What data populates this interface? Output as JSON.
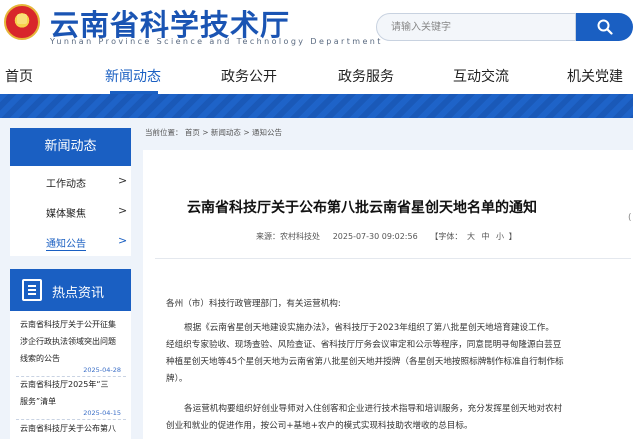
{
  "header": {
    "site_title": "云南省科学技术厅",
    "site_subtitle": "Yunnan Province Science and Technology Department",
    "search_placeholder": "请输入关键字"
  },
  "nav": [
    "首页",
    "新闻动态",
    "政务公开",
    "政务服务",
    "互动交流",
    "机关党建"
  ],
  "sidebar": {
    "section_title": "新闻动态",
    "items": [
      {
        "label": "工作动态",
        "chevron": ">"
      },
      {
        "label": "媒体聚焦",
        "chevron": ">"
      },
      {
        "label": "通知公告",
        "chevron": ">"
      }
    ],
    "hot_title": "热点资讯",
    "hot": [
      {
        "lines": [
          "云南省科技厅关于公开征集",
          "涉企行政执法领域突出问题",
          "线索的公告"
        ],
        "date": "2025-04-28"
      },
      {
        "lines": [
          "云南省科技厅2025年“三",
          "服务”清单"
        ],
        "date": "2025-04-15"
      },
      {
        "lines": [
          "云南省科技厅关于公布第八"
        ],
        "date": ""
      }
    ]
  },
  "breadcrumb": "当前位置： 首页 > 新闻动态 > 通知公告",
  "article": {
    "title": "云南省科技厅关于公布第八批云南省星创天地名单的通知",
    "meta_source": "来源：农村科技处",
    "meta_date": "2025-07-30 09:02:56",
    "meta_font_label": "【字体：",
    "meta_sizes": [
      "大",
      "中",
      "小"
    ],
    "meta_close": "】",
    "greeting": "各州（市）科技行政管理部门，有关运营机构:",
    "paragraphs": [
      [
        "根据《云南省星创天地建设实施办法》，省科技厅于2023年组织了第八批星创天地培育建设工作。",
        "经组织专家验收、现场查验、风险查证、省科技厅厅务会议审定和公示等程序，同意昆明寻甸隆源白芸豆",
        "种植星创天地等45个星创天地为云南省第八批星创天地并授牌（各星创天地按照标牌制作标准自行制作标",
        "牌）。"
      ],
      [
        "各运营机构要组织好创业导师对入住创客和企业进行技术指导和培训服务，充分发挥星创天地对农村",
        "创业和就业的促进作用，按公司+基地+农户的模式实现科技助农增收的总目标。"
      ]
    ]
  }
}
